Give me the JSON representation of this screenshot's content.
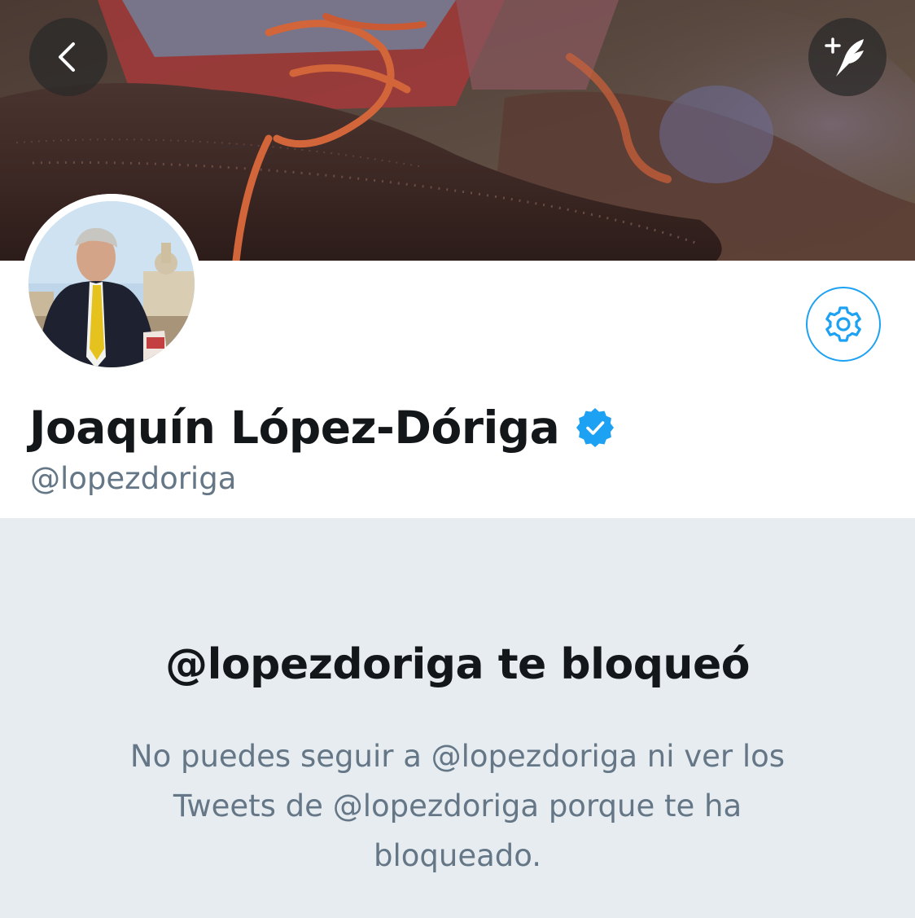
{
  "header": {
    "back_icon": "chevron-left-icon",
    "compose_icon": "compose-tweet-icon"
  },
  "profile": {
    "display_name": "Joaquín López-Dóriga",
    "handle": "@lopezdoriga",
    "verified_icon": "verified-badge-icon",
    "settings_icon": "gear-icon"
  },
  "blocked": {
    "title": "@lopezdoriga te bloqueó",
    "message": "No puedes seguir a @lopezdoriga ni ver los Tweets de @lopezdoriga porque te ha bloqueado."
  },
  "colors": {
    "accent": "#1da1f2",
    "text_primary": "#14171a",
    "text_secondary": "#657786",
    "panel_background": "#e6ecf0"
  }
}
